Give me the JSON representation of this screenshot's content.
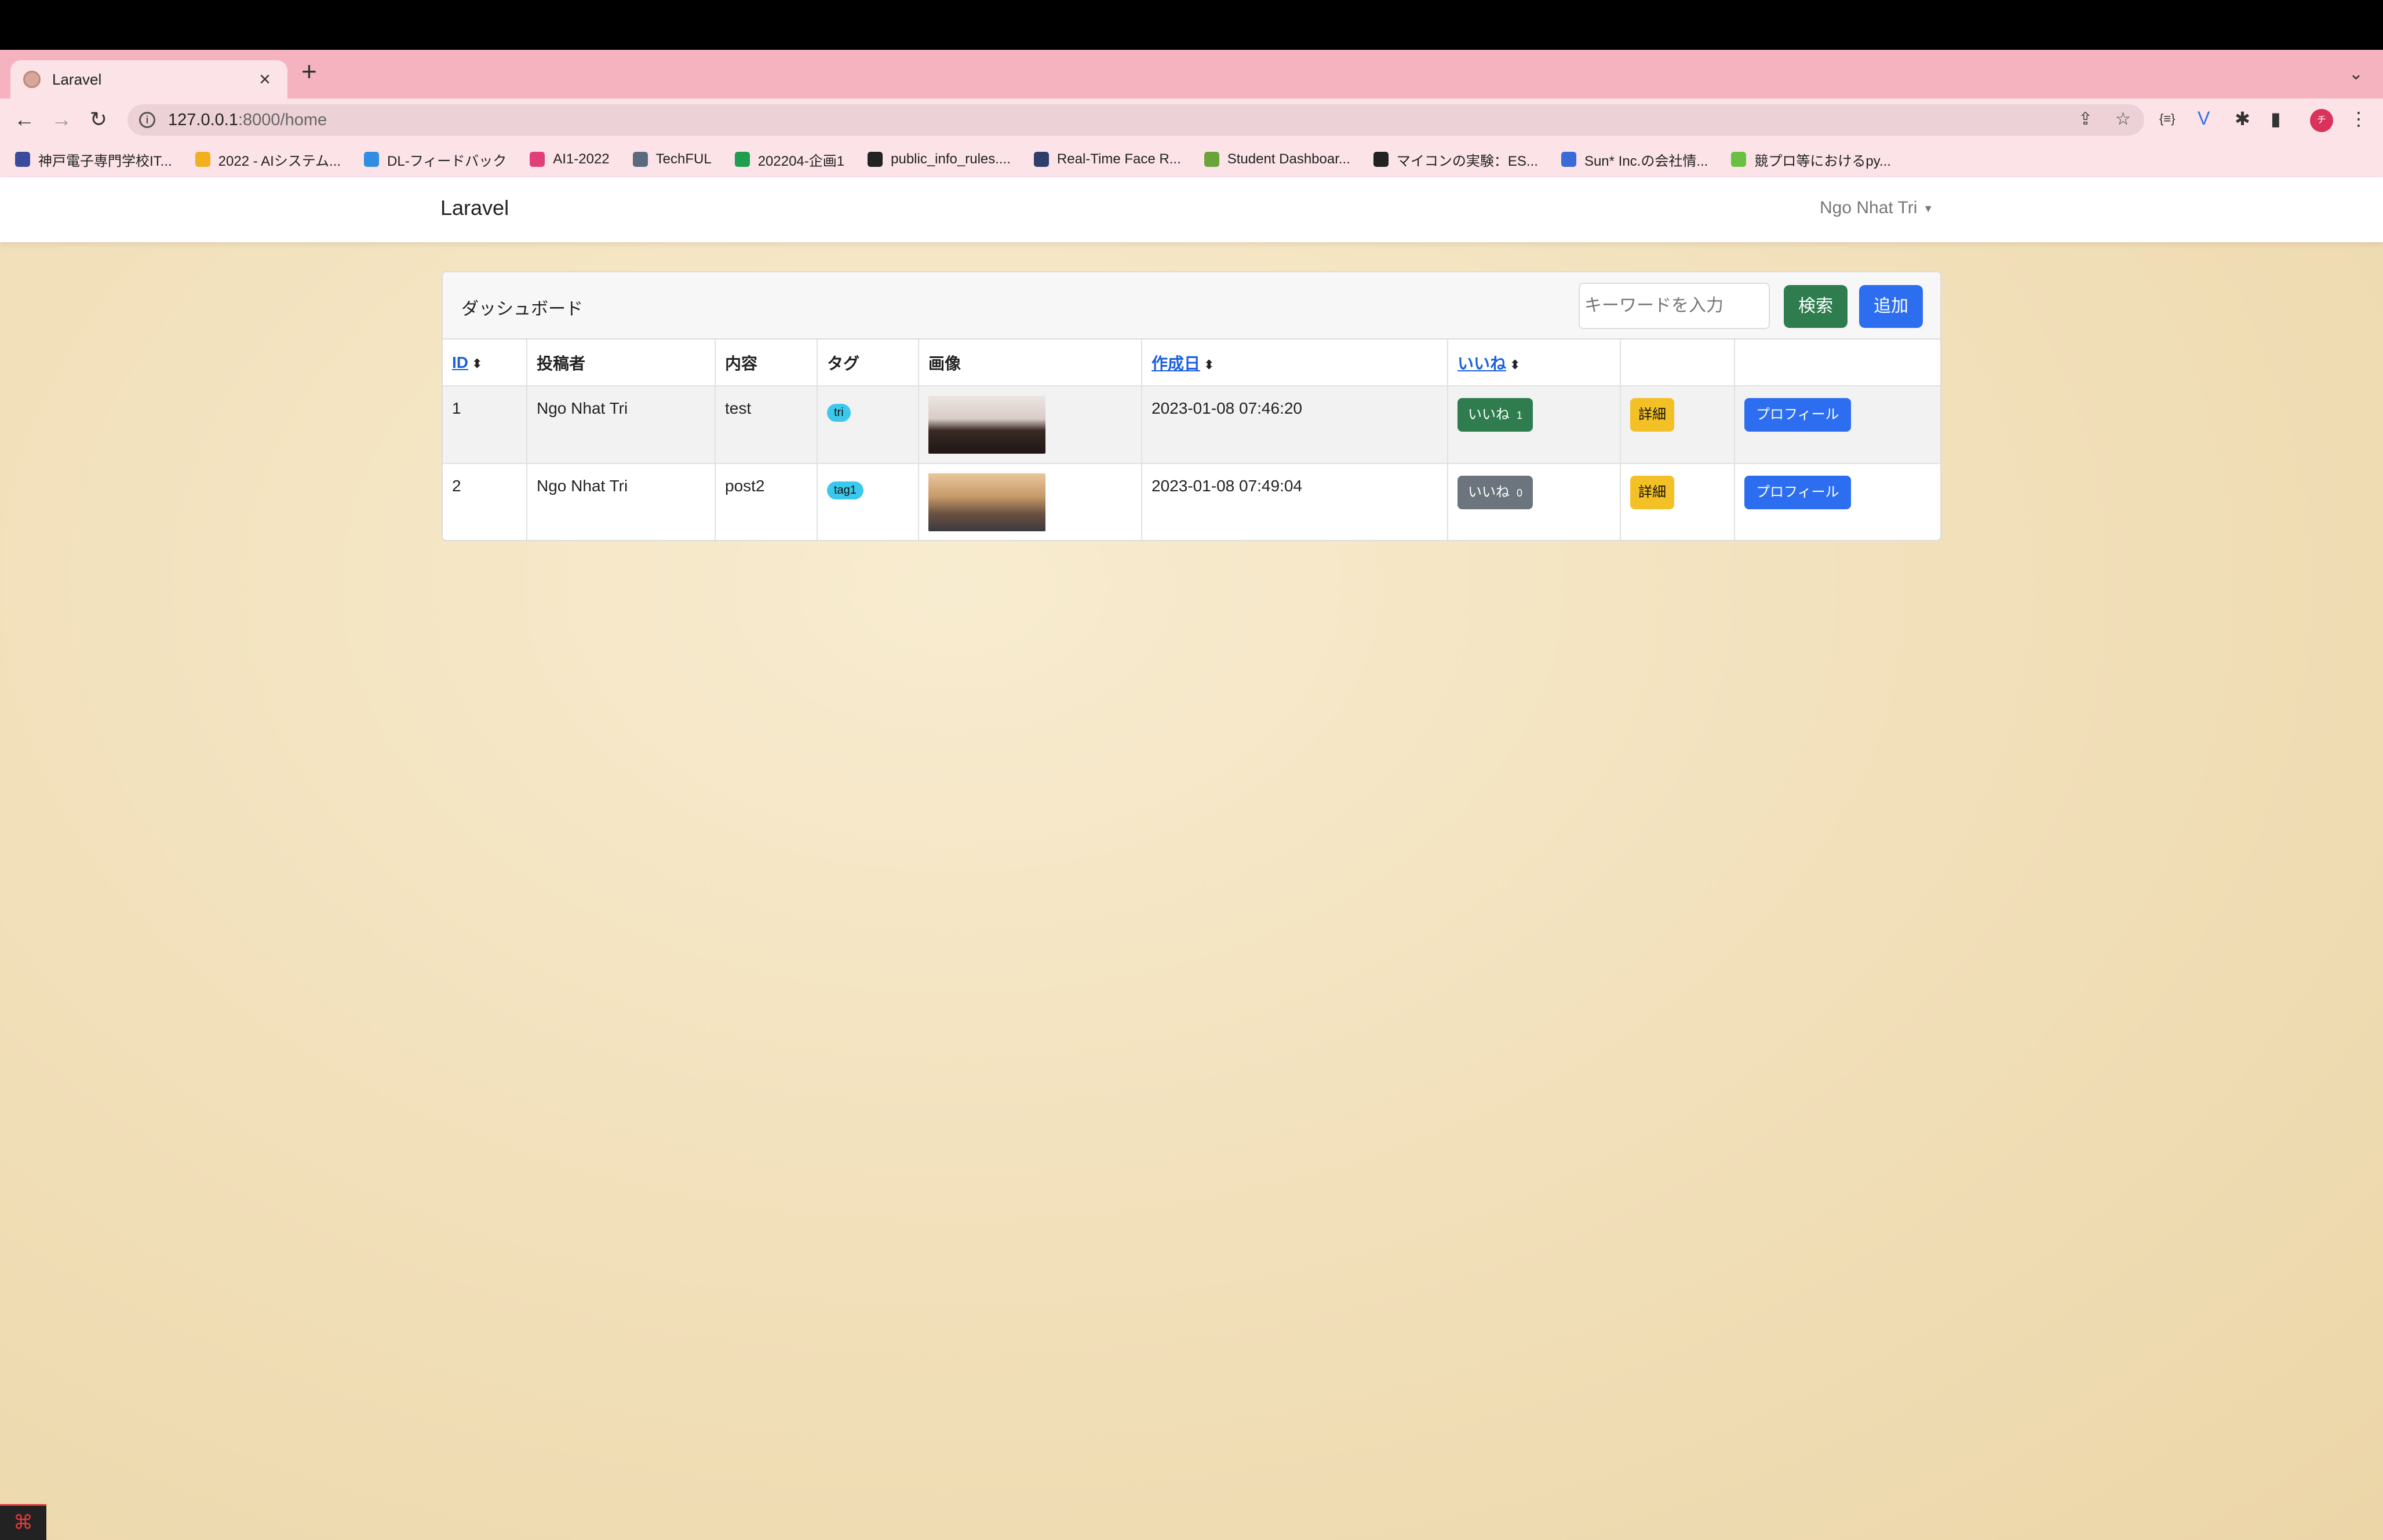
{
  "browser": {
    "tab_title": "Laravel",
    "tab_close": "×",
    "new_tab": "+",
    "tabs_menu": "⌄",
    "url_host": "127.0.0.1",
    "url_rest": ":8000/home",
    "bookmarks": [
      {
        "label": "神戸電子専門学校IT...",
        "color": "#3a4a9c"
      },
      {
        "label": "2022 - AIシステム...",
        "color": "#f2b01e"
      },
      {
        "label": "DL-フィードバック",
        "color": "#2f8de4"
      },
      {
        "label": "AI1-2022",
        "color": "#e0407a"
      },
      {
        "label": "TechFUL",
        "color": "#5a6b80"
      },
      {
        "label": "202204-企画1",
        "color": "#1e9e4e"
      },
      {
        "label": "public_info_rules....",
        "color": "#222222"
      },
      {
        "label": "Real-Time Face R...",
        "color": "#2e3e6a"
      },
      {
        "label": "Student Dashboar...",
        "color": "#6aa33a"
      },
      {
        "label": "マイコンの実験：ES...",
        "color": "#222222"
      },
      {
        "label": "Sun* Inc.の会社情...",
        "color": "#3a6ad8"
      },
      {
        "label": "競プロ等におけるpy...",
        "color": "#6ac040"
      }
    ]
  },
  "navbar": {
    "brand": "Laravel",
    "user": "Ngo Nhat Tri"
  },
  "card": {
    "title": "ダッシュボード",
    "search_placeholder": "キーワードを入力",
    "search_button": "検索",
    "add_button": "追加"
  },
  "table": {
    "headers": {
      "id": "ID",
      "author": "投稿者",
      "content": "内容",
      "tag": "タグ",
      "image": "画像",
      "created": "作成日",
      "likes": "いいね"
    },
    "sort_icon": "⬍",
    "rows": [
      {
        "id": "1",
        "author": "Ngo Nhat Tri",
        "content": "test",
        "tag": "tri",
        "created": "2023-01-08 07:46:20",
        "like_label": "いいね",
        "like_count": "1",
        "detail": "詳細",
        "profile": "プロフィール"
      },
      {
        "id": "2",
        "author": "Ngo Nhat Tri",
        "content": "post2",
        "tag": "tag1",
        "created": "2023-01-08 07:49:04",
        "like_label": "いいね",
        "like_count": "0",
        "detail": "詳細",
        "profile": "プロフィール"
      }
    ]
  }
}
